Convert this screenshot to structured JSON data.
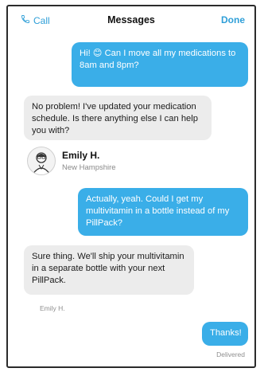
{
  "nav": {
    "left_label": "Call",
    "left_icon": "phone-icon",
    "title": "Messages",
    "right_label": "Done"
  },
  "colors": {
    "accent": "#2f9fd8",
    "outgoing_bubble": "#3aaee8",
    "incoming_bubble": "#ececec"
  },
  "messages": [
    {
      "direction": "outgoing",
      "text_before_emoji": "Hi!",
      "emoji": "😊",
      "text_after_emoji": "Can I move all my medications to 8am and 8pm?"
    },
    {
      "direction": "incoming",
      "text": "No problem! I've updated your medication schedule. Is there anything else I can help you with?"
    },
    {
      "direction": "outgoing",
      "text": "Actually, yeah. Could I get my multivitamin in a bottle instead of my PillPack?"
    },
    {
      "direction": "incoming",
      "text": "Sure thing. We'll ship your multivitamin in a separate bottle with your next PillPack."
    },
    {
      "direction": "outgoing",
      "text": "Thanks!"
    }
  ],
  "agent": {
    "name": "Emily H.",
    "location": "New Hampshire",
    "avatar_icon": "person-avatar-icon"
  },
  "captions": {
    "incoming_sender": "Emily H.",
    "delivery_status": "Delivered"
  }
}
